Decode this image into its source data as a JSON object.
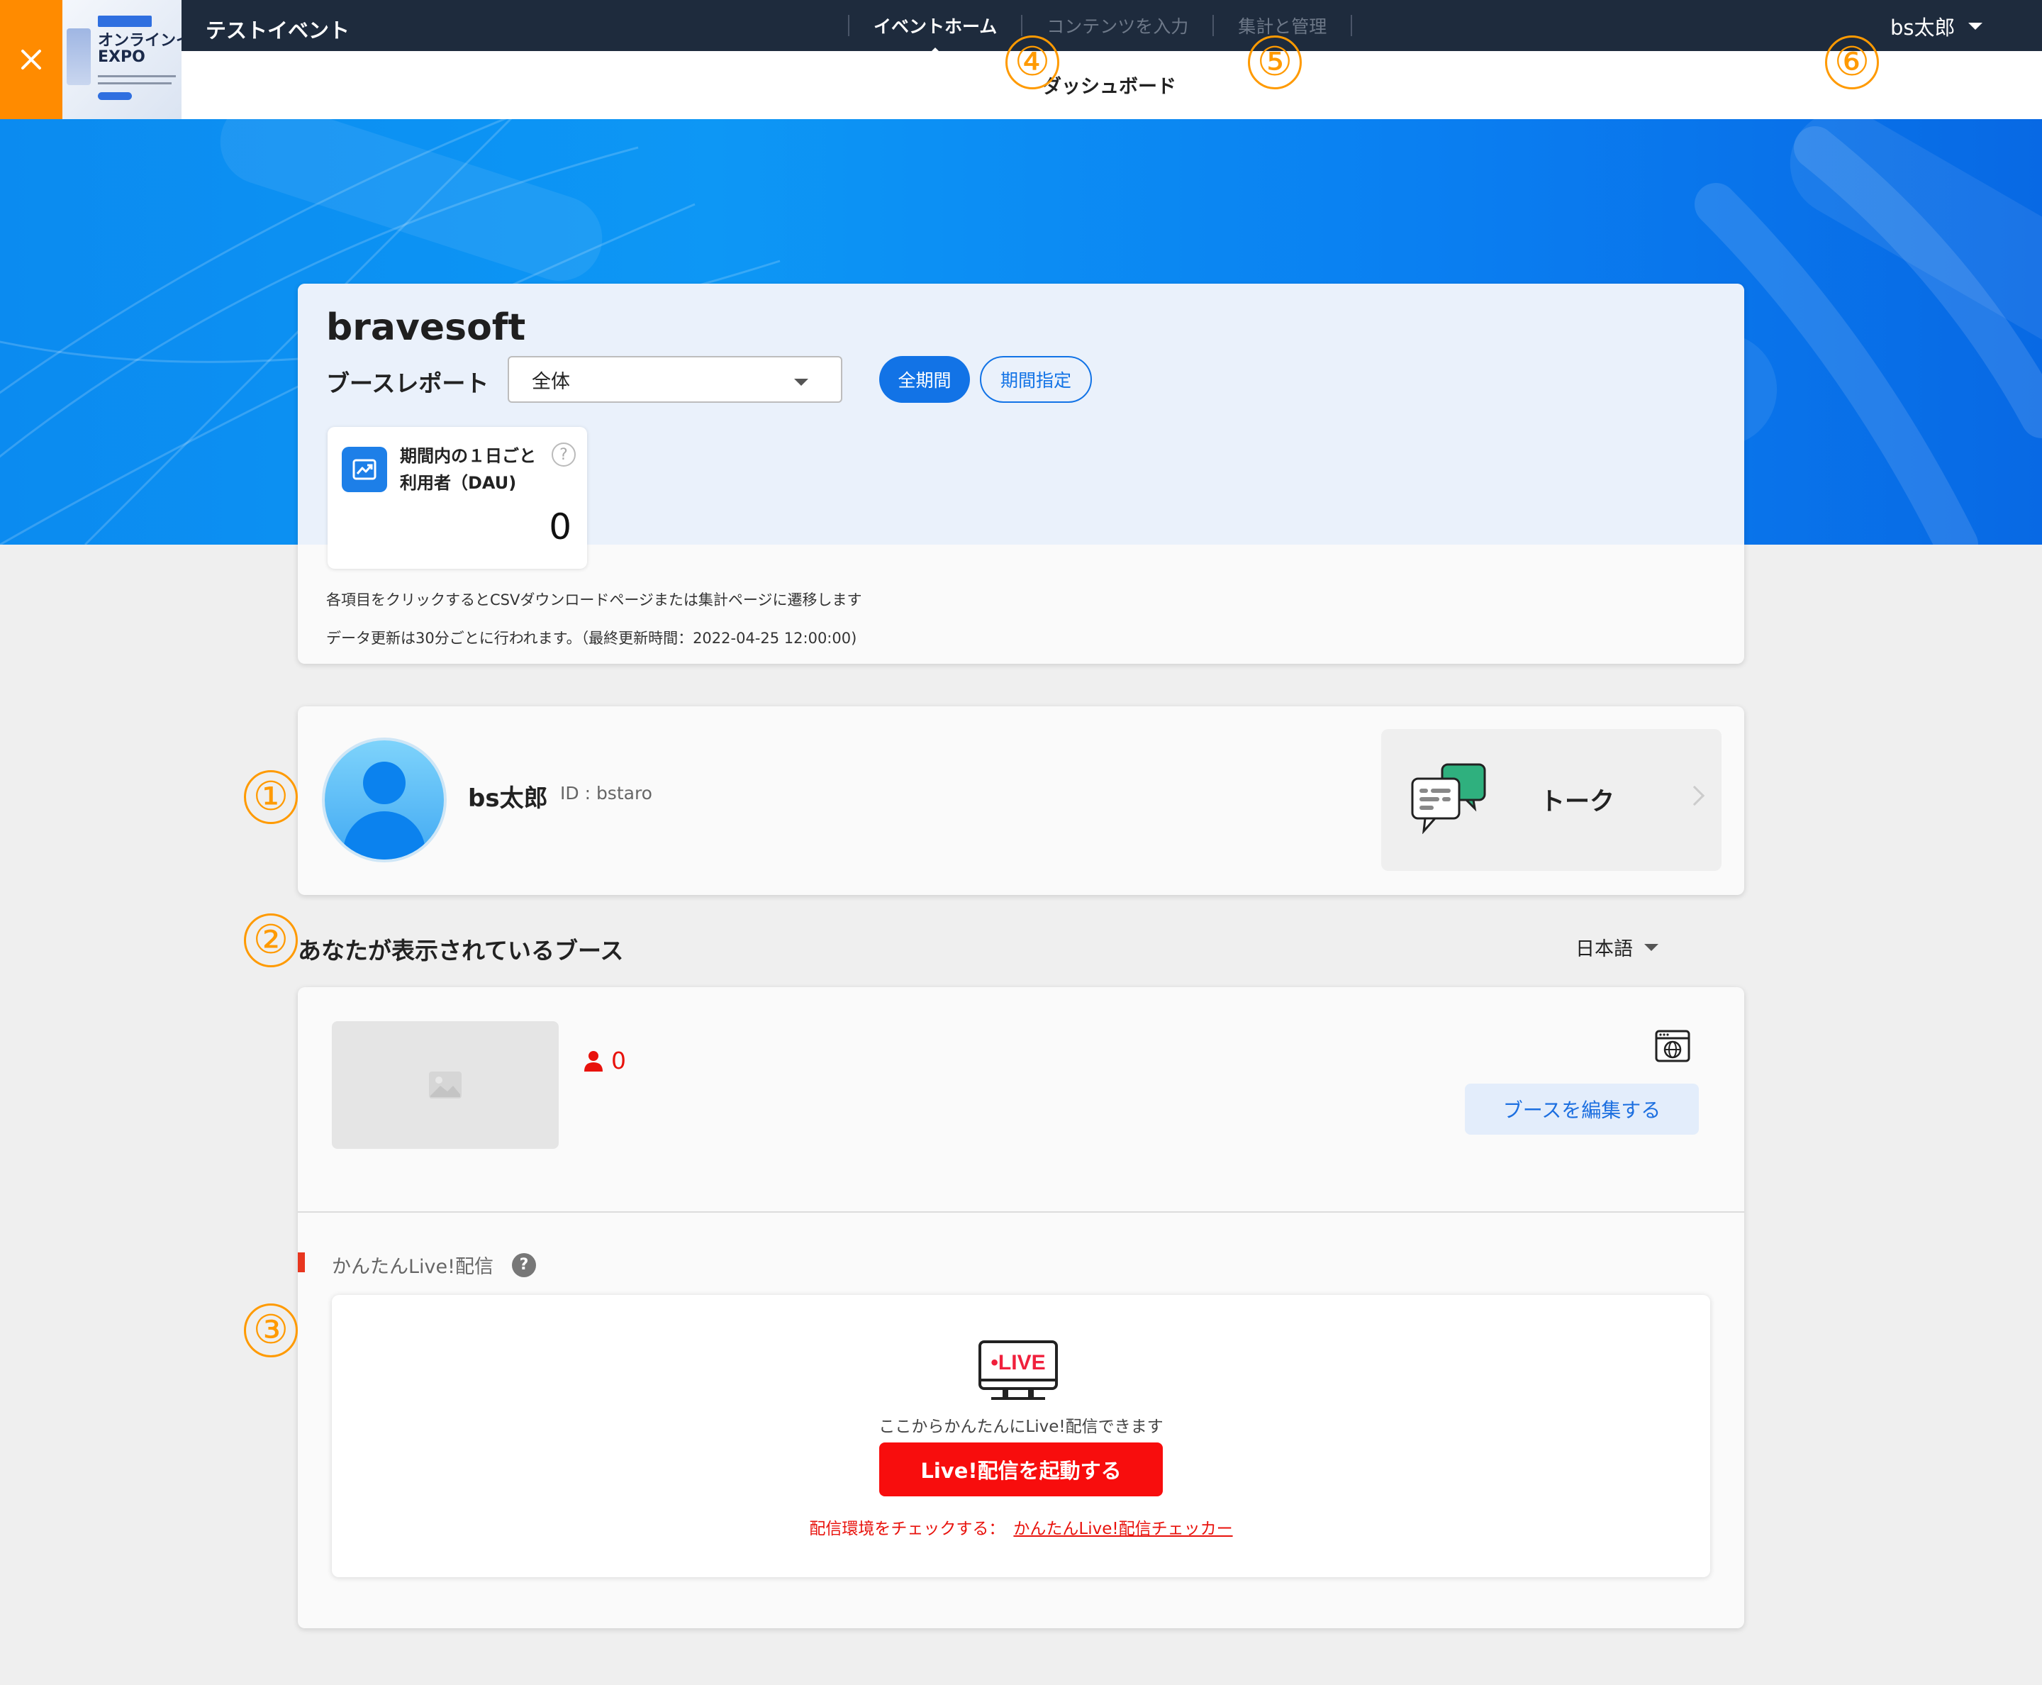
{
  "header": {
    "event_name": "テストイベント",
    "thumbnail_title_line1": "オンラインイ",
    "thumbnail_title_line2": "EXPO",
    "nav": [
      {
        "label": "イベントホーム",
        "active": true
      },
      {
        "label": "コンテンツを入力",
        "active": false
      },
      {
        "label": "集計と管理",
        "active": false
      }
    ],
    "subtitle": "ダッシュボード",
    "user_name": "bs太郎"
  },
  "report": {
    "company": "bravesoft",
    "label": "ブースレポート",
    "select_value": "全体",
    "period_all": "全期間",
    "period_range": "期間指定",
    "dau_title_line1": "期間内の１日ごと",
    "dau_title_line2": "利用者（DAU)",
    "dau_help": "?",
    "dau_value": "0",
    "note1": "各項目をクリックするとCSVダウンロードページまたは集計ページに遷移します",
    "note2": "データ更新は30分ごとに行われます。（最終更新時間：2022-04-25 12:00:00)"
  },
  "profile": {
    "name": "bs太郎",
    "id": "ID : bstaro",
    "talk_label": "トーク"
  },
  "booth_section": {
    "title": "あなたが表示されているブース",
    "language": "日本語",
    "visitor_count": "0",
    "edit_button": "ブースを編集する"
  },
  "live": {
    "label": "かんたんLive!配信",
    "help": "?",
    "badge": "•LIVE",
    "description": "ここからかんたんにLive!配信できます",
    "start_button": "Live!配信を起動する",
    "checker_prefix": "配信環境をチェックする：",
    "checker_link": "かんたんLive!配信チェッカー"
  },
  "annotations": [
    "①",
    "②",
    "③",
    "④",
    "⑤",
    "⑥"
  ],
  "colors": {
    "topbar": "#1e2b3d",
    "accent_orange": "#ff8b00",
    "primary_blue": "#1273e6",
    "live_red": "#f80d0d",
    "annotation_orange": "#ff9a00"
  }
}
